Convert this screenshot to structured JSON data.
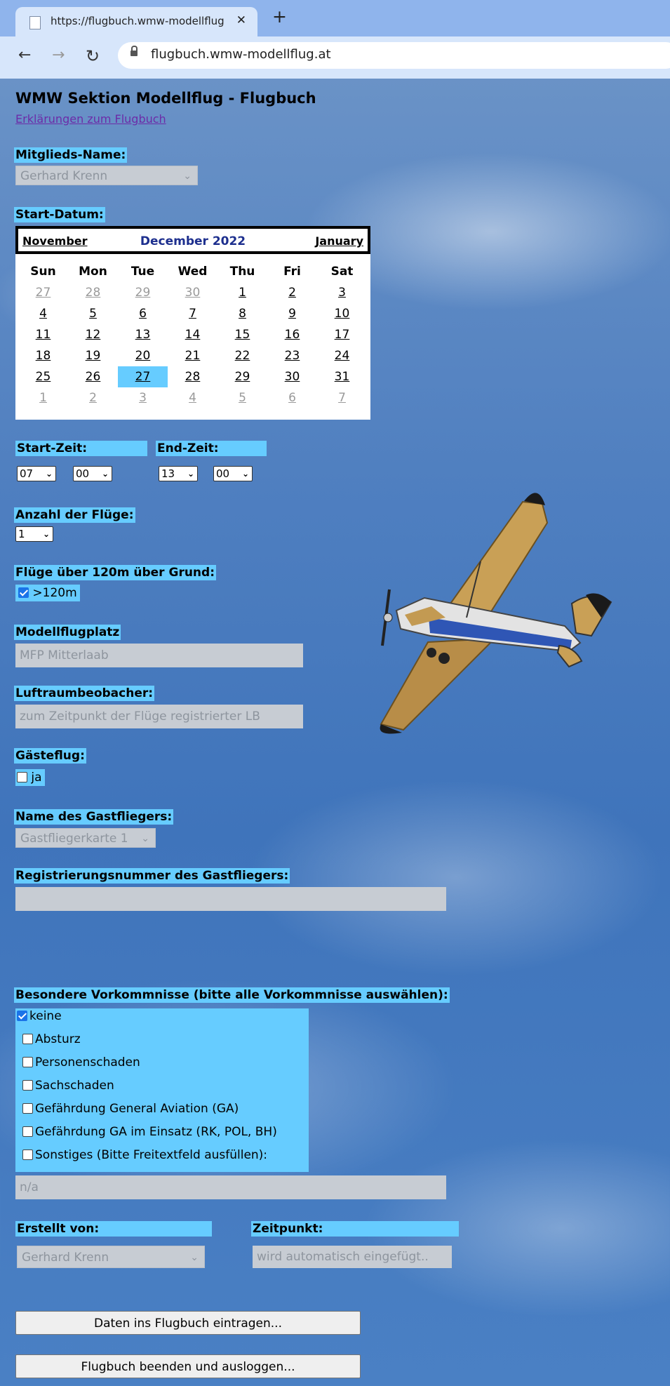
{
  "browser": {
    "tab_title": "https://flugbuch.wmw-modellflug",
    "new_tab": "+",
    "url": "flugbuch.wmw-modellflug.at"
  },
  "page": {
    "title": "WMW Sektion Modellflug - Flugbuch",
    "help_link": "Erklärungen zum Flugbuch"
  },
  "member": {
    "label": "Mitglieds-Name:",
    "value": "Gerhard Krenn"
  },
  "start_date": {
    "label": "Start-Datum:",
    "prev": "November",
    "month": "December 2022",
    "next": "January",
    "weekdays": [
      "Sun",
      "Mon",
      "Tue",
      "Wed",
      "Thu",
      "Fri",
      "Sat"
    ],
    "weeks": [
      [
        "27",
        "28",
        "29",
        "30",
        "1",
        "2",
        "3"
      ],
      [
        "4",
        "5",
        "6",
        "7",
        "8",
        "9",
        "10"
      ],
      [
        "11",
        "12",
        "13",
        "14",
        "15",
        "16",
        "17"
      ],
      [
        "18",
        "19",
        "20",
        "21",
        "22",
        "23",
        "24"
      ],
      [
        "25",
        "26",
        "27",
        "28",
        "29",
        "30",
        "31"
      ],
      [
        "1",
        "2",
        "3",
        "4",
        "5",
        "6",
        "7"
      ]
    ],
    "selected_day": "27"
  },
  "time": {
    "start_label": "Start-Zeit:",
    "end_label": "End-Zeit:",
    "start_hour": "07",
    "start_min": "00",
    "end_hour": "13",
    "end_min": "00"
  },
  "flights": {
    "label": "Anzahl der Flüge:",
    "value": "1"
  },
  "above120": {
    "label": "Flüge über 120m über Grund:",
    "option": ">120m",
    "checked": true
  },
  "airfield": {
    "label": "Modellflugplatz",
    "value": "MFP Mitterlaab"
  },
  "observer": {
    "label": "Luftraumbeobacher:",
    "value": "zum Zeitpunkt der Flüge registrierter LB"
  },
  "guest_flight": {
    "label": "Gästeflug:",
    "option": "ja",
    "checked": false
  },
  "guest_name": {
    "label": "Name des Gastfliegers:",
    "value": "Gastfliegerkarte 1"
  },
  "guest_reg": {
    "label": "Registrierungsnummer des Gastfliegers:",
    "value": ""
  },
  "incidents": {
    "label": "Besondere Vorkommnisse (bitte alle Vorkommnisse auswählen):",
    "items": [
      {
        "label": "keine",
        "checked": true
      },
      {
        "label": "Absturz",
        "checked": false
      },
      {
        "label": "Personenschaden",
        "checked": false
      },
      {
        "label": "Sachschaden",
        "checked": false
      },
      {
        "label": "Gefährdung General Aviation (GA)",
        "checked": false
      },
      {
        "label": "Gefährdung GA im Einsatz (RK, POL, BH)",
        "checked": false
      },
      {
        "label": "Sonstiges (Bitte Freitextfeld ausfüllen):",
        "checked": false
      }
    ],
    "freetext": "n/a"
  },
  "created_by": {
    "label": "Erstellt von:",
    "value": "Gerhard Krenn"
  },
  "timestamp": {
    "label": "Zeitpunkt:",
    "value": "wird automatisch eingefügt.."
  },
  "buttons": {
    "submit": "Daten ins Flugbuch eintragen...",
    "logout": "Flugbuch beenden und ausloggen..."
  },
  "colors": {
    "highlight": "#66ccff",
    "selected_day": "#66ccff",
    "checkbox": "#1a73e8"
  },
  "icons": {
    "back": "back-arrow-icon",
    "forward": "forward-arrow-icon",
    "reload": "reload-icon",
    "lock": "lock-icon"
  }
}
